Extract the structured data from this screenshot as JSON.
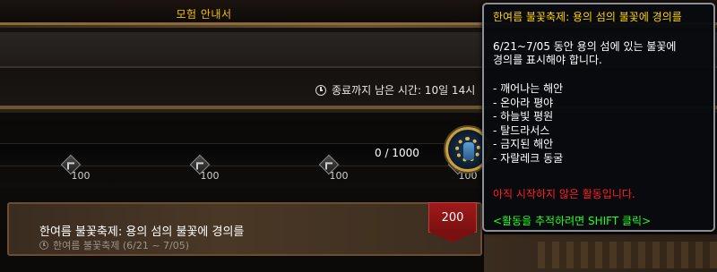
{
  "window": {
    "title": "모험 안내서"
  },
  "header": {
    "timer_label": "종료까지 남은 시간: 10일 14시"
  },
  "progress": {
    "current": 0,
    "max": 1000,
    "fraction": 0,
    "label": "0 / 1000",
    "milestones": [
      {
        "value": "100"
      },
      {
        "value": "100"
      },
      {
        "value": "100"
      },
      {
        "value": "100"
      }
    ]
  },
  "activity": {
    "name": "한여름 불꽃축제: 용의 섬의 불꽃에 경의를",
    "subtitle": "한여름 불꽃축제 (6/21 ~ 7/05)",
    "points": "200"
  },
  "tooltip": {
    "title": "한여름 불꽃축제: 용의 섬의 불꽃에 경의를",
    "desc_line1": "6/21~7/05 동안 용의 섬에 있는 불꽃에",
    "desc_line2": "경의를 표시해야 합니다.",
    "zones": [
      "- 깨어나는 해안",
      "- 온아라 평야",
      "- 하늘빛 평원",
      "- 탈드라서스",
      "- 금지된 해안",
      "- 자랄레크 동굴"
    ],
    "status": "아직 시작하지 않은 활동입니다.",
    "hint": "<활동을 추적하려면 SHIFT 클릭>"
  },
  "colors": {
    "title_gold": "#ffd100",
    "status_red": "#ff2020",
    "hint_green": "#20ff20",
    "reward_red": "#8a1414"
  },
  "icons": [
    "clock-icon",
    "milestone-diamond-icon",
    "reward-orb-icon"
  ]
}
